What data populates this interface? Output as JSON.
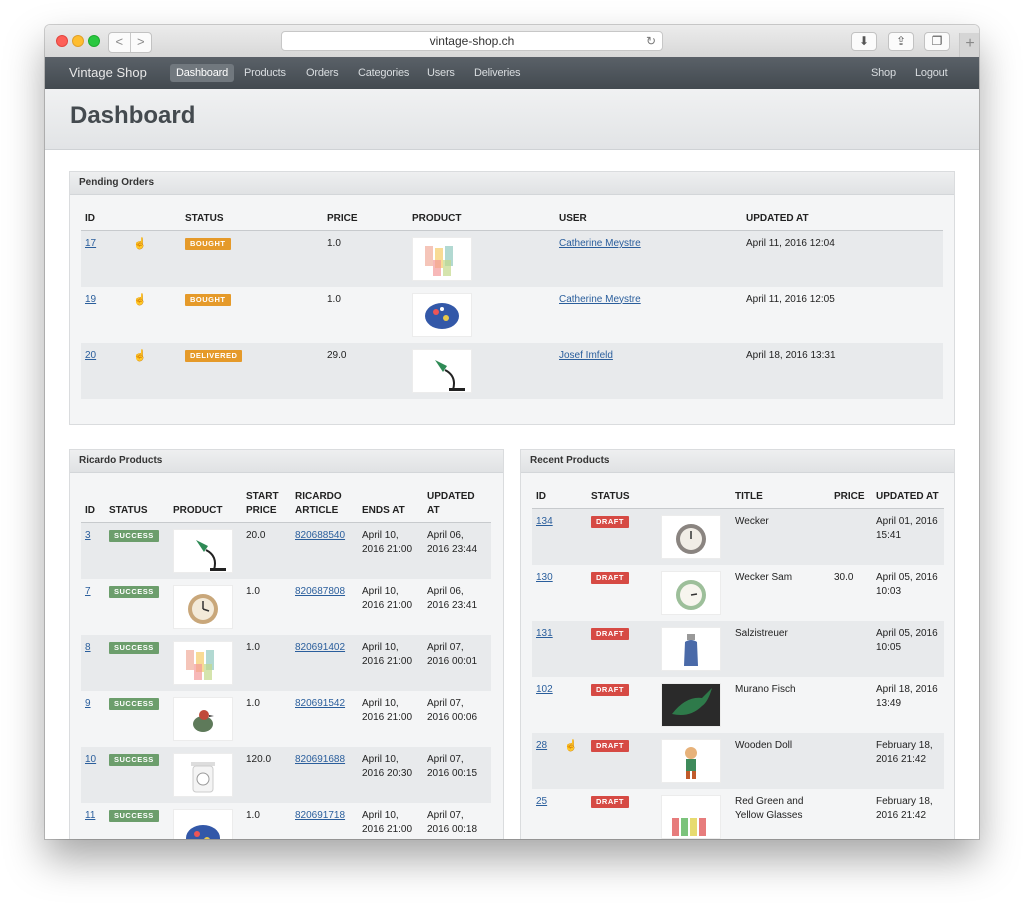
{
  "browser": {
    "url": "vintage-shop.ch",
    "back": "<",
    "forward": ">",
    "reload_icon": "reload-icon",
    "download_icon": "download-icon",
    "share_icon": "share-icon",
    "tabs_icon": "tabs-icon",
    "new_tab": "+"
  },
  "nav": {
    "brand": "Vintage Shop",
    "items": [
      "Dashboard",
      "Products",
      "Orders",
      "Categories",
      "Users",
      "Deliveries"
    ],
    "active": "Dashboard",
    "right": [
      "Shop",
      "Logout"
    ]
  },
  "page_title": "Dashboard",
  "pending_orders": {
    "title": "Pending Orders",
    "headers": [
      "ID",
      "STATUS",
      "PRICE",
      "PRODUCT",
      "USER",
      "UPDATED AT"
    ],
    "rows": [
      {
        "id": "17",
        "status": "BOUGHT",
        "price": "1.0",
        "product_icon": "glasses",
        "user": "Catherine Meystre",
        "updated": "April 11, 2016 12:04"
      },
      {
        "id": "19",
        "status": "BOUGHT",
        "price": "1.0",
        "product_icon": "egg",
        "user": "Catherine Meystre",
        "updated": "April 11, 2016 12:05"
      },
      {
        "id": "20",
        "status": "DELIVERED",
        "price": "29.0",
        "product_icon": "lamp",
        "user": "Josef Imfeld",
        "updated": "April 18, 2016 13:31"
      }
    ]
  },
  "ricardo_products": {
    "title": "Ricardo Products",
    "headers": [
      "ID",
      "STATUS",
      "PRODUCT",
      "START PRICE",
      "RICARDO ARTICLE",
      "ENDS AT",
      "UPDATED AT"
    ],
    "rows": [
      {
        "id": "3",
        "status": "SUCCESS",
        "product_icon": "lamp",
        "start_price": "20.0",
        "article": "820688540",
        "ends": "April 10, 2016 21:00",
        "updated": "April 06, 2016 23:44"
      },
      {
        "id": "7",
        "status": "SUCCESS",
        "product_icon": "clock",
        "start_price": "1.0",
        "article": "820687808",
        "ends": "April 10, 2016 21:00",
        "updated": "April 06, 2016 23:41"
      },
      {
        "id": "8",
        "status": "SUCCESS",
        "product_icon": "glasses",
        "start_price": "1.0",
        "article": "820691402",
        "ends": "April 10, 2016 21:00",
        "updated": "April 07, 2016 00:01"
      },
      {
        "id": "9",
        "status": "SUCCESS",
        "product_icon": "bird",
        "start_price": "1.0",
        "article": "820691542",
        "ends": "April 10, 2016 21:00",
        "updated": "April 07, 2016 00:06"
      },
      {
        "id": "10",
        "status": "SUCCESS",
        "product_icon": "scale",
        "start_price": "120.0",
        "article": "820691688",
        "ends": "April 10, 2016 20:30",
        "updated": "April 07, 2016 00:15"
      },
      {
        "id": "11",
        "status": "SUCCESS",
        "product_icon": "egg",
        "start_price": "1.0",
        "article": "820691718",
        "ends": "April 10, 2016 21:00",
        "updated": "April 07, 2016 00:18"
      }
    ]
  },
  "recent_products": {
    "title": "Recent Products",
    "headers": [
      "ID",
      "STATUS",
      "TITLE",
      "PRICE",
      "UPDATED AT"
    ],
    "rows": [
      {
        "id": "134",
        "status": "DRAFT",
        "reserved": false,
        "product_icon": "clock",
        "title": "Wecker",
        "price": "",
        "updated": "April 01, 2016 15:41"
      },
      {
        "id": "130",
        "status": "DRAFT",
        "reserved": false,
        "product_icon": "clock-green",
        "title": "Wecker Sam",
        "price": "30.0",
        "updated": "April 05, 2016 10:03"
      },
      {
        "id": "131",
        "status": "DRAFT",
        "reserved": false,
        "product_icon": "shaker",
        "title": "Salzistreuer",
        "price": "",
        "updated": "April 05, 2016 10:05"
      },
      {
        "id": "102",
        "status": "DRAFT",
        "reserved": false,
        "product_icon": "fish",
        "title": "Murano Fisch",
        "price": "",
        "updated": "April 18, 2016 13:49"
      },
      {
        "id": "28",
        "status": "DRAFT",
        "reserved": true,
        "product_icon": "doll",
        "title": "Wooden Doll",
        "price": "",
        "updated": "February 18, 2016 21:42"
      },
      {
        "id": "25",
        "status": "DRAFT",
        "reserved": false,
        "product_icon": "glasses",
        "title": "Red Green and Yellow Glasses",
        "price": "",
        "updated": "February 18, 2016 21:42"
      }
    ]
  },
  "colors": {
    "badge_bought": "#e59a2a",
    "badge_success": "#6c9e6c",
    "badge_draft": "#d64a44",
    "link": "#2a5e9c",
    "navbar": "#4b5258"
  }
}
